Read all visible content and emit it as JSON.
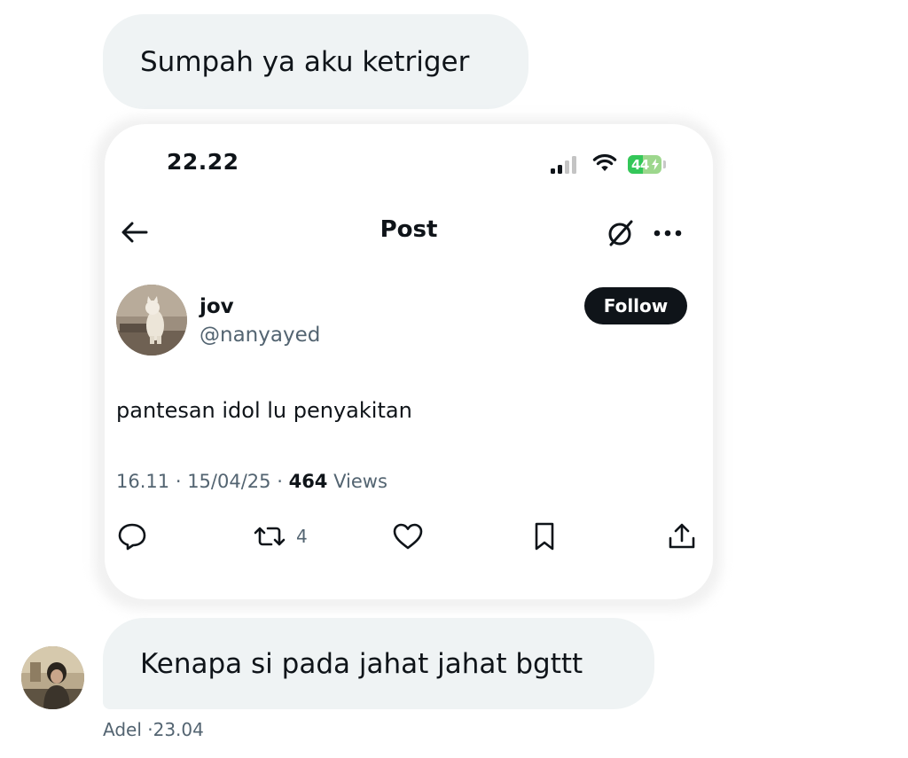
{
  "messages": {
    "first_text": "Sumpah ya aku ketriger",
    "second_text": "Kenapa si pada jahat jahat bgttt",
    "sender_name": "Adel",
    "separator": "·",
    "time": "23.04"
  },
  "embedded_post": {
    "status_bar": {
      "time": "22.22",
      "battery_level": "44",
      "battery_charge_fraction": 0.44,
      "signal_bars_active": 2,
      "signal_bars_total": 4
    },
    "nav": {
      "back_icon": "arrow-left-icon",
      "title": "Post",
      "grok_icon": "grok-slash-circle-icon",
      "more_icon": "more-horizontal-icon"
    },
    "author": {
      "display_name": "jov",
      "handle": "@nanyayed",
      "follow_label": "Follow"
    },
    "text": "pantesan idol lu penyakitan",
    "meta": {
      "time": "16.11",
      "date": "15/04/25",
      "views_count": "464",
      "views_label": "Views",
      "separator": "·"
    },
    "actions": {
      "reply_icon": "reply-bubble-icon",
      "repost_icon": "repost-icon",
      "repost_count": "4",
      "like_icon": "heart-icon",
      "bookmark_icon": "bookmark-icon",
      "share_icon": "share-upload-icon"
    }
  },
  "colors": {
    "bubble_background": "#eff3f4",
    "primary_text": "#0f1419",
    "secondary_text": "#536471",
    "follow_button": "#0f1419",
    "battery_green": "#34c759"
  }
}
